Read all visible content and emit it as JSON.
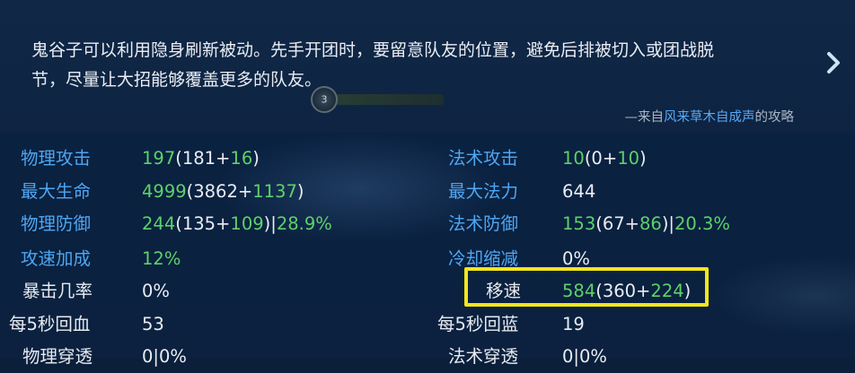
{
  "tip": {
    "line1": "鬼谷子可以利用隐身刷新被动。先手开团时，要留意队友的位置，避免后排被切入或团战脱",
    "line2": "节，尽量让大招能够覆盖更多的队友。",
    "source_prefix": "—来自",
    "source_author": "风来草木自成声",
    "source_suffix": "的攻略",
    "skill_level": "3"
  },
  "colors": {
    "label_blue": "#4fa6f2",
    "bonus_green": "#5ed16a",
    "highlight_yellow": "#f3e61c",
    "author_blue": "#57a9f5"
  },
  "stats_left": [
    {
      "label": "物理攻击",
      "label_color": "blue",
      "v1": "197",
      "v2": "(181+",
      "v3": "16",
      "v4": ")"
    },
    {
      "label": "最大生命",
      "label_color": "blue",
      "v1": "4999",
      "v2": "(3862+",
      "v3": "1137",
      "v4": ")"
    },
    {
      "label": "物理防御",
      "label_color": "blue",
      "v1": "244",
      "v2": "(135+",
      "v3": "109",
      "v4": ")|",
      "v5": "28.9%"
    },
    {
      "label": "攻速加成",
      "label_color": "blue",
      "v1": "12%"
    },
    {
      "label": "暴击几率",
      "label_color": "white",
      "v1": "0%"
    },
    {
      "label": "每5秒回血",
      "label_color": "white",
      "v1": "53"
    },
    {
      "label": "物理穿透",
      "label_color": "white",
      "v1": "0|0%"
    }
  ],
  "stats_right": [
    {
      "label": "法术攻击",
      "label_color": "blue",
      "v1": "10",
      "v2": "(0+",
      "v3": "10",
      "v4": ")"
    },
    {
      "label": "最大法力",
      "label_color": "blue",
      "v1": "644"
    },
    {
      "label": "法术防御",
      "label_color": "blue",
      "v1": "153",
      "v2": "(67+",
      "v3": "86",
      "v4": ")|",
      "v5": "20.3%"
    },
    {
      "label": "冷却缩减",
      "label_color": "blue",
      "v1": "0%"
    },
    {
      "label": "移速",
      "label_color": "white",
      "v1": "584",
      "v2": "(360+",
      "v3": "224",
      "v4": ")"
    },
    {
      "label": "每5秒回蓝",
      "label_color": "white",
      "v1": "19"
    },
    {
      "label": "法术穿透",
      "label_color": "white",
      "v1": "0|0%"
    }
  ]
}
